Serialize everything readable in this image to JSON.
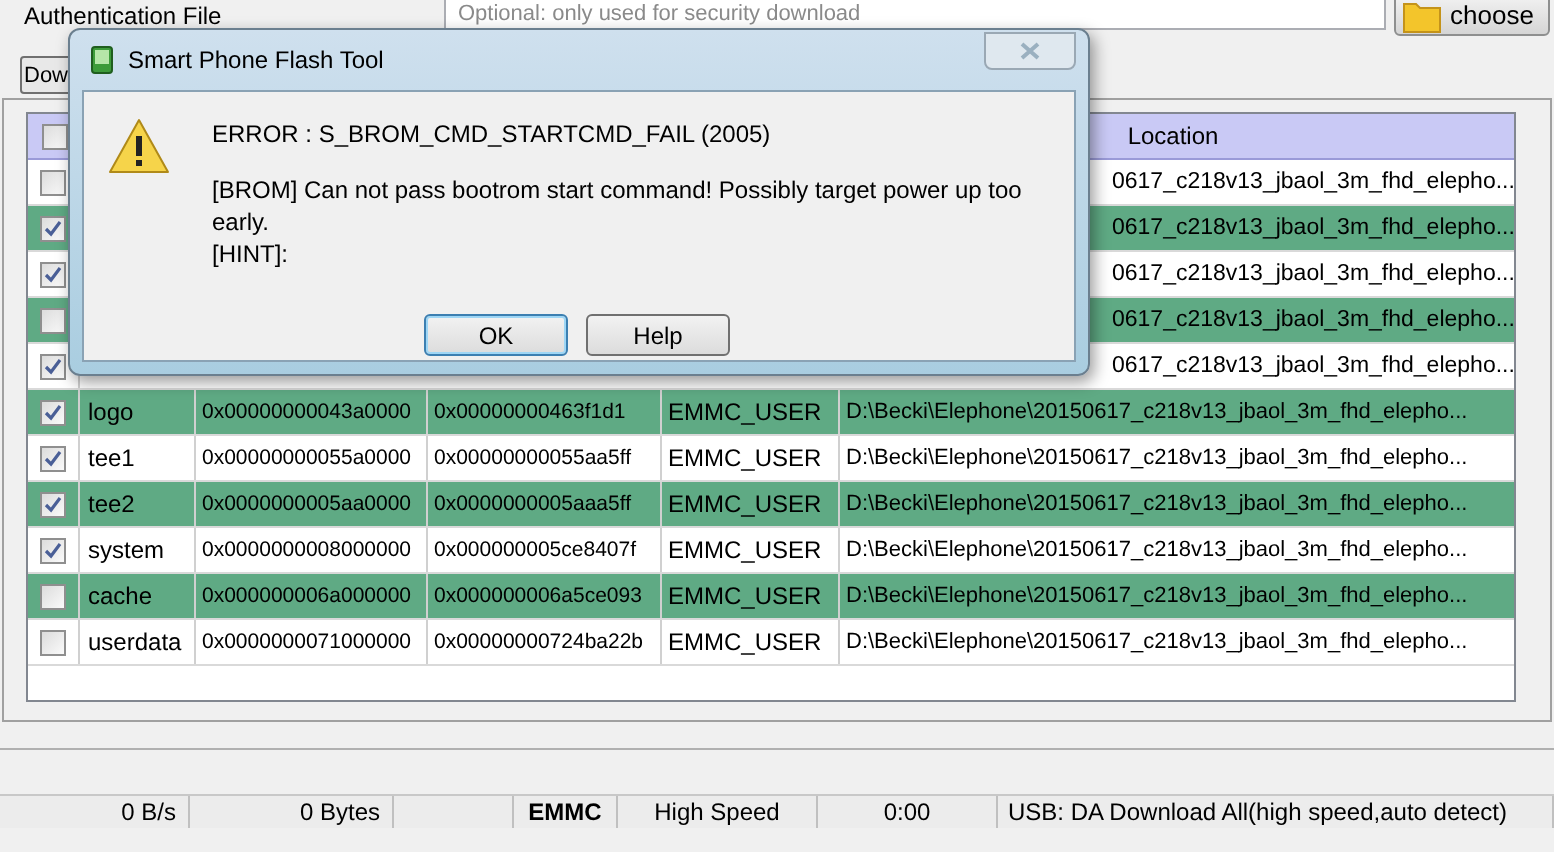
{
  "auth": {
    "label": "Authentication File",
    "placeholder": "Optional: only used for security download",
    "button": "choose"
  },
  "download_button": "Dow",
  "table": {
    "header_checked": false,
    "location_header": "Location",
    "rows": [
      {
        "checked": false,
        "location": "0617_c218v13_jbaol_3m_fhd_elepho..."
      },
      {
        "checked": true,
        "location": "0617_c218v13_jbaol_3m_fhd_elepho..."
      },
      {
        "checked": true,
        "location": "0617_c218v13_jbaol_3m_fhd_elepho..."
      },
      {
        "checked": false,
        "location": "0617_c218v13_jbaol_3m_fhd_elepho..."
      },
      {
        "checked": true,
        "location": "0617_c218v13_jbaol_3m_fhd_elepho..."
      },
      {
        "checked": true,
        "name": "logo",
        "begin": "0x00000000043a0000",
        "end": "0x00000000463f1d1",
        "region": "EMMC_USER",
        "location": "D:\\Becki\\Elephone\\20150617_c218v13_jbaol_3m_fhd_elepho..."
      },
      {
        "checked": true,
        "name": "tee1",
        "begin": "0x00000000055a0000",
        "end": "0x00000000055aa5ff",
        "region": "EMMC_USER",
        "location": "D:\\Becki\\Elephone\\20150617_c218v13_jbaol_3m_fhd_elepho..."
      },
      {
        "checked": true,
        "name": "tee2",
        "begin": "0x0000000005aa0000",
        "end": "0x0000000005aaa5ff",
        "region": "EMMC_USER",
        "location": "D:\\Becki\\Elephone\\20150617_c218v13_jbaol_3m_fhd_elepho..."
      },
      {
        "checked": true,
        "name": "system",
        "begin": "0x0000000008000000",
        "end": "0x000000005ce8407f",
        "region": "EMMC_USER",
        "location": "D:\\Becki\\Elephone\\20150617_c218v13_jbaol_3m_fhd_elepho..."
      },
      {
        "checked": false,
        "name": "cache",
        "begin": "0x000000006a000000",
        "end": "0x000000006a5ce093",
        "region": "EMMC_USER",
        "location": "D:\\Becki\\Elephone\\20150617_c218v13_jbaol_3m_fhd_elepho..."
      },
      {
        "checked": false,
        "name": "userdata",
        "begin": "0x0000000071000000",
        "end": "0x00000000724ba22b",
        "region": "EMMC_USER",
        "location": "D:\\Becki\\Elephone\\20150617_c218v13_jbaol_3m_fhd_elepho..."
      }
    ]
  },
  "status_bar": [
    {
      "text": "0 B/s",
      "kind": "right"
    },
    {
      "text": "0 Bytes",
      "kind": "right"
    },
    {
      "kind": "blank"
    },
    {
      "text": "EMMC",
      "kind": "bold"
    },
    {
      "text": "High Speed",
      "kind": "center"
    },
    {
      "text": "0:00",
      "kind": "center"
    },
    {
      "text": "USB: DA Download All(high speed,auto detect)",
      "kind": "left"
    }
  ],
  "dialog": {
    "title": "Smart Phone Flash Tool",
    "error": "ERROR : S_BROM_CMD_STARTCMD_FAIL (2005)",
    "message": "[BROM] Can not pass bootrom start command! Possibly target power up too early.",
    "hint": "[HINT]:",
    "buttons": [
      "OK",
      "Help"
    ]
  }
}
